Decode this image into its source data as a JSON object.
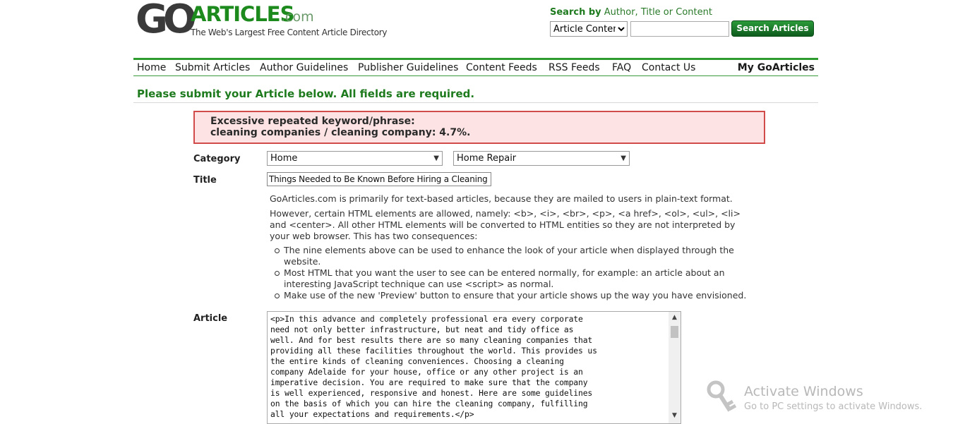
{
  "logo": {
    "go": "GO",
    "articles": "ARTICLES",
    "com": ".com",
    "tagline": "The Web's Largest Free Content Article Directory"
  },
  "search": {
    "label_strong": "Search by",
    "label_light": "Author, Title or Content",
    "select_value": "Article Content",
    "input_value": "",
    "button_label": "Search Articles"
  },
  "nav": {
    "items": [
      "Home",
      "Submit Articles",
      "Author Guidelines",
      "Publisher Guidelines",
      "Content Feeds",
      "RSS Feeds",
      "FAQ",
      "Contact Us"
    ],
    "my_account": "My GoArticles"
  },
  "page": {
    "heading": "Please submit your Article below. All fields are required."
  },
  "error": {
    "line1": "Excessive repeated keyword/phrase:",
    "line2": "cleaning companies / cleaning company: 4.7%."
  },
  "form": {
    "category_label": "Category",
    "category_value": "Home",
    "subcategory_value": "Home Repair",
    "title_label": "Title",
    "title_value": "Things Needed to Be Known Before Hiring a Cleaning",
    "info_p1": "GoArticles.com is primarily for text-based articles, because they are mailed to users in plain-text format.",
    "info_p2": "However, certain HTML elements are allowed, namely: <b>, <i>, <br>, <p>, <a href>, <ol>, <ul>, <li> and <center>. All other HTML elements will be converted to HTML entities so they are not interpreted by your web browser. This has two consequences:",
    "info_bullets": [
      "The nine elements above can be used to enhance the look of your article when displayed through the website.",
      "Most HTML that you want the user to see can be entered normally, for example: an article about an interesting JavaScript technique can use <script> as normal.",
      "Make use of the new 'Preview' button to ensure that your article shows up the way you have envisioned."
    ],
    "article_label": "Article",
    "article_value": "<p>In this advance and completely professional era every corporate\nneed not only better infrastructure, but neat and tidy office as\nwell. And for best results there are so many cleaning companies that\nproviding all these facilities throughout the world. This provides us\nthe entire kinds of cleaning conveniences. Choosing a cleaning\ncompany Adelaide for your house, office or any other project is an\nimperative decision. You are required to make sure that the company\nis well experienced, responsive and honest. Here are some guidelines\non the basis of which you can hire the cleaning company, fulfilling\nall your expectations and requirements.</p>"
  },
  "watermark": {
    "title": "Activate Windows",
    "subtitle": "Go to PC settings to activate Windows."
  }
}
